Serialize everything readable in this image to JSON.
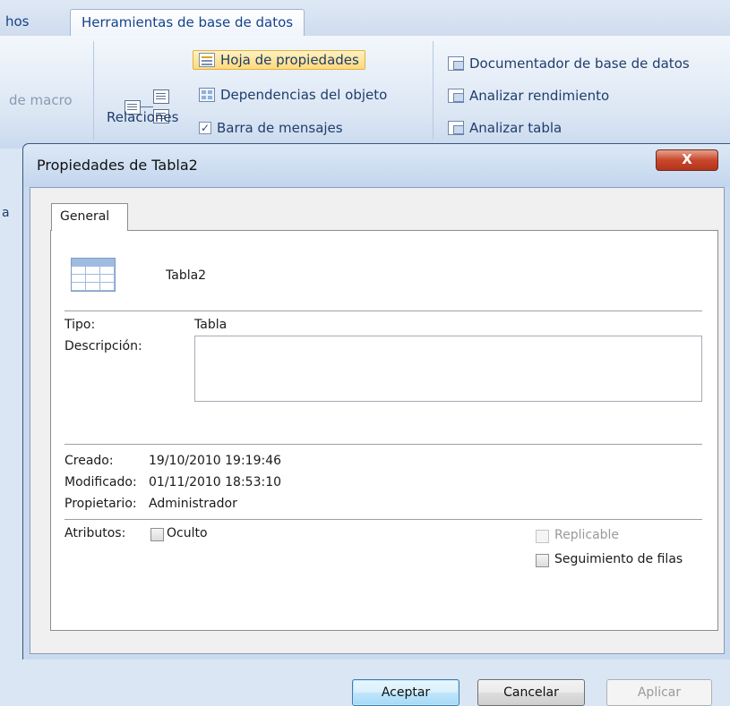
{
  "ribbon": {
    "prev_tab": "hos",
    "active_tab": "Herramientas de base de datos",
    "macro_label": "de macro",
    "relaciones_label": "Relaciones",
    "hoja_propiedades": "Hoja de propiedades",
    "dependencias": "Dependencias del objeto",
    "barra_mensajes": "Barra de mensajes",
    "barra_mensajes_checked": true,
    "documentador": "Documentador de base de datos",
    "analizar_rendimiento": "Analizar rendimiento",
    "analizar_tabla": "Analizar tabla",
    "left_edge_fragment": "a"
  },
  "dialog": {
    "title": "Propiedades de Tabla2",
    "close_glyph": "X",
    "tab_label": "General",
    "object_name": "Tabla2",
    "tipo_label": "Tipo:",
    "tipo_value": "Tabla",
    "descripcion_label": "Descripción:",
    "descripcion_value": "",
    "creado_label": "Creado:",
    "creado_value": "19/10/2010 19:19:46",
    "modificado_label": "Modificado:",
    "modificado_value": "01/11/2010 18:53:10",
    "propietario_label": "Propietario:",
    "propietario_value": "Administrador",
    "atributos_label": "Atributos:",
    "oculto_label": "Oculto",
    "oculto_checked": false,
    "replicable_label": "Replicable",
    "replicable_enabled": false,
    "seguimiento_label": "Seguimiento de filas",
    "seguimiento_checked": false,
    "aceptar_label": "Aceptar",
    "cancelar_label": "Cancelar",
    "aplicar_label": "Aplicar",
    "aplicar_enabled": false
  },
  "colors": {
    "ribbon_text": "#1f3d6b",
    "highlight": "#ffd97a",
    "close_button": "#c9472c"
  }
}
